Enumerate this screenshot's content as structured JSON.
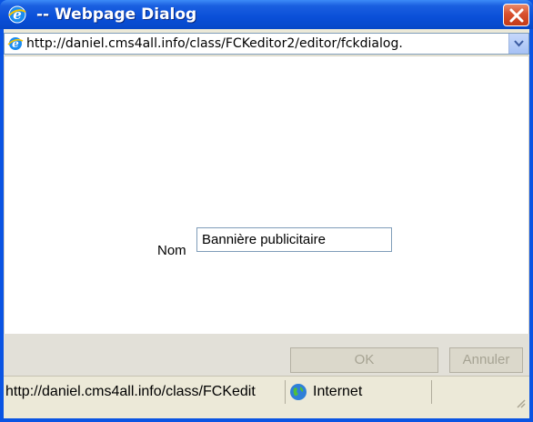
{
  "window": {
    "title": "-- Webpage Dialog",
    "icon": "ie-icon"
  },
  "address_bar": {
    "url": "http://daniel.cms4all.info/class/FCKeditor2/editor/fckdialog."
  },
  "form": {
    "name_label": "Nom",
    "name_value": "Bannière publicitaire"
  },
  "buttons": {
    "ok_label": "OK",
    "cancel_label": "Annuler"
  },
  "status_bar": {
    "url": "http://daniel.cms4all.info/class/FCKedit",
    "zone": "Internet"
  },
  "colors": {
    "titlebar": "#0a4fd8",
    "close": "#d8502e",
    "frame": "#ece9d8",
    "disabled_text": "#a6a393"
  }
}
